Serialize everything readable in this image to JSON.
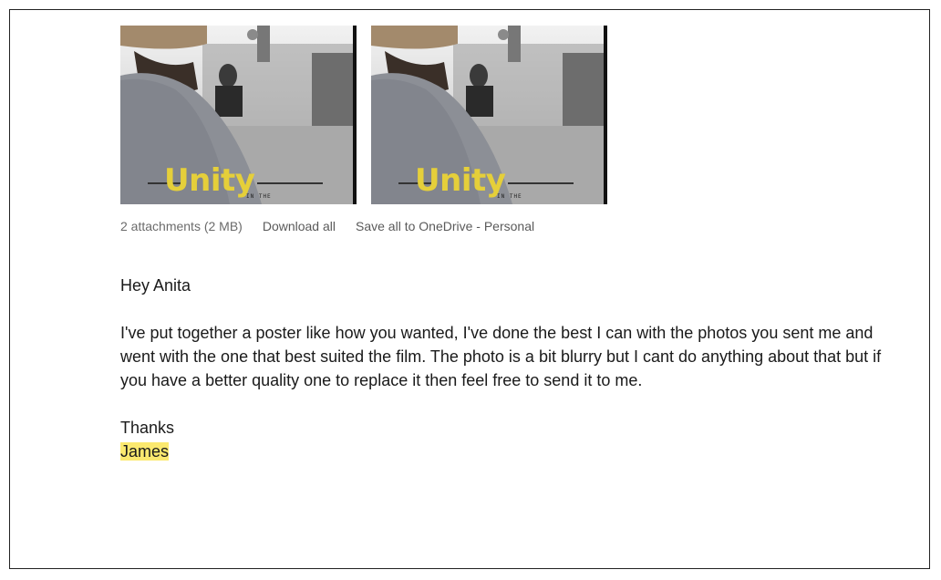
{
  "attachments": {
    "items": [
      {
        "caption": "Unity",
        "small_text": "IN THE"
      },
      {
        "caption": "Unity",
        "small_text": "IN THE"
      }
    ],
    "summary": "2 attachments (2 MB)",
    "download_all_label": "Download all",
    "save_onedrive_label": "Save all to OneDrive - Personal"
  },
  "message": {
    "greeting": "Hey Anita",
    "body": "I've put together a poster like how you wanted, I've done the best I can with the photos you sent me and went with the one that best suited the film. The photo is a bit blurry but I cant do anything about that but if you have a better quality one to replace it then feel free to send it to me.",
    "closing": "Thanks",
    "signature": "James"
  },
  "colors": {
    "signature_highlight": "#fbe96f",
    "poster_caption": "#e5cf3a"
  }
}
